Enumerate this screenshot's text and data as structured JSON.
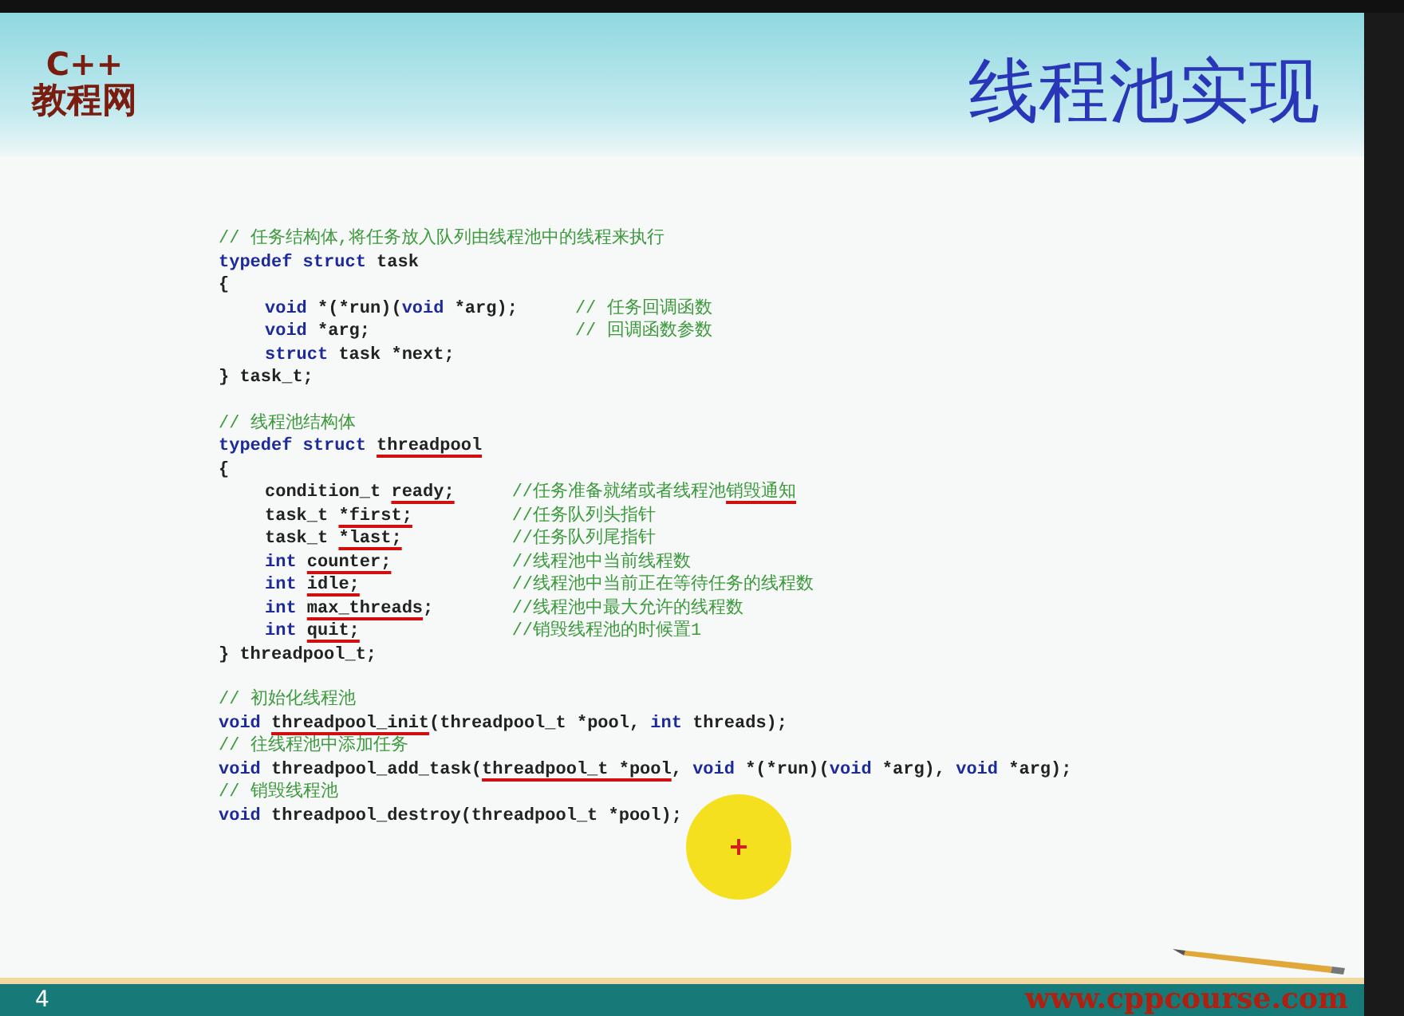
{
  "logo": {
    "line_1": "C++",
    "line_2": "教程网"
  },
  "title": "线程池实现",
  "code_blocks": [
    {
      "lines": [
        {
          "indented": false,
          "code": [
            {
              "text": "// 任务结构体,将任务放入队列由线程池中的线程来执行",
              "kind": "comment",
              "underlined": false
            }
          ]
        },
        {
          "indented": false,
          "code": [
            {
              "text": "typedef struct",
              "kind": "keyword",
              "underlined": false
            },
            {
              "text": " task",
              "kind": "plain",
              "underlined": false
            }
          ]
        },
        {
          "indented": false,
          "code": [
            {
              "text": "{",
              "kind": "plain",
              "underlined": false
            }
          ]
        },
        {
          "indented": true,
          "code": [
            {
              "text": "void",
              "kind": "keyword",
              "underlined": false
            },
            {
              "text": " *(*run)(",
              "kind": "plain",
              "underlined": false
            },
            {
              "text": "void",
              "kind": "keyword",
              "underlined": false
            },
            {
              "text": " *arg);",
              "kind": "plain",
              "underlined": false
            }
          ],
          "comment": [
            {
              "text": "// 任务回调函数",
              "underlined": false
            }
          ]
        },
        {
          "indented": true,
          "code": [
            {
              "text": "void",
              "kind": "keyword",
              "underlined": false
            },
            {
              "text": " *arg;",
              "kind": "plain",
              "underlined": false
            }
          ],
          "comment": [
            {
              "text": "// 回调函数参数",
              "underlined": false
            }
          ]
        },
        {
          "indented": true,
          "code": [
            {
              "text": "struct",
              "kind": "keyword",
              "underlined": false
            },
            {
              "text": " task *next;",
              "kind": "plain",
              "underlined": false
            }
          ]
        },
        {
          "indented": false,
          "code": [
            {
              "text": "} task_t;",
              "kind": "plain",
              "underlined": false
            }
          ]
        }
      ]
    },
    {
      "lines": [
        {
          "indented": false,
          "code": [
            {
              "text": "// 线程池结构体",
              "kind": "comment",
              "underlined": false
            }
          ]
        },
        {
          "indented": false,
          "code": [
            {
              "text": "typedef struct ",
              "kind": "keyword",
              "underlined": false
            },
            {
              "text": "threadpool",
              "kind": "plain",
              "underlined": true
            }
          ]
        },
        {
          "indented": false,
          "code": [
            {
              "text": "{",
              "kind": "plain",
              "underlined": false
            }
          ]
        },
        {
          "indented": true,
          "code": [
            {
              "text": "condition_t ",
              "kind": "plain",
              "underlined": false
            },
            {
              "text": "ready;",
              "kind": "plain",
              "underlined": true
            }
          ],
          "comment": [
            {
              "text": "//任务准备就绪或者线程池",
              "underlined": false
            },
            {
              "text": "销毁通知",
              "underlined": true
            }
          ]
        },
        {
          "indented": true,
          "code": [
            {
              "text": "task_t ",
              "kind": "plain",
              "underlined": false
            },
            {
              "text": "*first;",
              "kind": "plain",
              "underlined": true
            }
          ],
          "comment": [
            {
              "text": "//任务队列头指针",
              "underlined": false
            }
          ]
        },
        {
          "indented": true,
          "code": [
            {
              "text": "task_t ",
              "kind": "plain",
              "underlined": false
            },
            {
              "text": "*last;",
              "kind": "plain",
              "underlined": true
            }
          ],
          "comment": [
            {
              "text": "//任务队列尾指针",
              "underlined": false
            }
          ]
        },
        {
          "indented": true,
          "code": [
            {
              "text": "int ",
              "kind": "keyword",
              "underlined": false
            },
            {
              "text": "counter;",
              "kind": "plain",
              "underlined": true
            }
          ],
          "comment": [
            {
              "text": "//线程池中当前线程数",
              "underlined": false
            }
          ]
        },
        {
          "indented": true,
          "code": [
            {
              "text": "int ",
              "kind": "keyword",
              "underlined": false
            },
            {
              "text": "idle;",
              "kind": "plain",
              "underlined": true
            }
          ],
          "comment": [
            {
              "text": "//线程池中当前正在等待任务的线程数",
              "underlined": false
            }
          ]
        },
        {
          "indented": true,
          "code": [
            {
              "text": "int ",
              "kind": "keyword",
              "underlined": false
            },
            {
              "text": "max_threads",
              "kind": "plain",
              "underlined": true
            },
            {
              "text": ";",
              "kind": "plain",
              "underlined": false
            }
          ],
          "comment": [
            {
              "text": "//线程池中最大允许的线程数",
              "underlined": false
            }
          ]
        },
        {
          "indented": true,
          "code": [
            {
              "text": "int ",
              "kind": "keyword",
              "underlined": false
            },
            {
              "text": "quit;",
              "kind": "plain",
              "underlined": true
            }
          ],
          "comment": [
            {
              "text": "//销毁线程池的时候置1",
              "underlined": false
            }
          ]
        },
        {
          "indented": false,
          "code": [
            {
              "text": "} threadpool_t;",
              "kind": "plain",
              "underlined": false
            }
          ]
        }
      ]
    },
    {
      "lines": [
        {
          "indented": false,
          "code": [
            {
              "text": "// 初始化线程池",
              "kind": "comment",
              "underlined": false
            }
          ]
        },
        {
          "indented": false,
          "code": [
            {
              "text": "void ",
              "kind": "keyword",
              "underlined": false
            },
            {
              "text": "threadpool_init",
              "kind": "plain",
              "underlined": true
            },
            {
              "text": "(threadpool_t *pool, ",
              "kind": "plain",
              "underlined": false
            },
            {
              "text": "int",
              "kind": "keyword",
              "underlined": false
            },
            {
              "text": " threads);",
              "kind": "plain",
              "underlined": false
            }
          ]
        },
        {
          "indented": false,
          "code": [
            {
              "text": "// 往线程池中添加任务",
              "kind": "comment",
              "underlined": false
            }
          ]
        },
        {
          "indented": false,
          "code": [
            {
              "text": "void",
              "kind": "keyword",
              "underlined": false
            },
            {
              "text": " threadpool_add_task(",
              "kind": "plain",
              "underlined": false
            },
            {
              "text": "threadpool_t *pool",
              "kind": "plain",
              "underlined": true
            },
            {
              "text": ", ",
              "kind": "plain",
              "underlined": false
            },
            {
              "text": "void",
              "kind": "keyword",
              "underlined": false
            },
            {
              "text": " *(*run)(",
              "kind": "plain",
              "underlined": false
            },
            {
              "text": "void",
              "kind": "keyword",
              "underlined": false
            },
            {
              "text": " *arg), ",
              "kind": "plain",
              "underlined": false
            },
            {
              "text": "void",
              "kind": "keyword",
              "underlined": false
            },
            {
              "text": " *arg);",
              "kind": "plain",
              "underlined": false
            }
          ]
        },
        {
          "indented": false,
          "code": [
            {
              "text": "// 销毁线程池",
              "kind": "comment",
              "underlined": false
            }
          ]
        },
        {
          "indented": false,
          "code": [
            {
              "text": "void",
              "kind": "keyword",
              "underlined": false
            },
            {
              "text": " threadpool_destroy(threadpool_t *pool);",
              "kind": "plain",
              "underlined": false
            }
          ]
        }
      ]
    }
  ],
  "footer": {
    "page_number": "4",
    "url": "www.cppcourse.com"
  }
}
